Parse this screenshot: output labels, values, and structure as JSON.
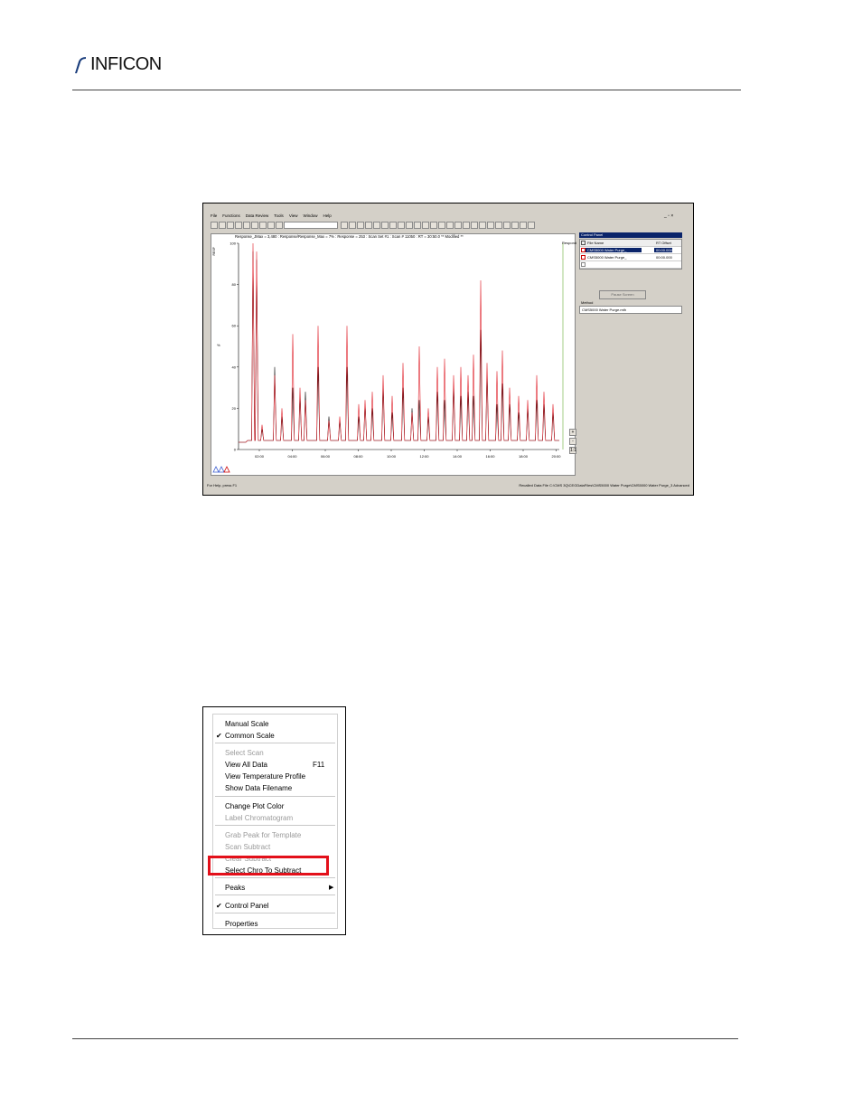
{
  "header": {
    "brand": "INFICON"
  },
  "screenshot1": {
    "menu": [
      "File",
      "Functions",
      "Data Review",
      "Tools",
      "View",
      "Window",
      "Help"
    ],
    "window_controls": "_ ▫ ×",
    "plot_header": "Response_JMax = 3,480 : Response/Response_Max = 7% : Response = 253 : Scan Set #1 : Scan # 11050 : RT = 30:50.0 ** Modified **",
    "respond_label": "Respond",
    "y_unit": "%",
    "y_ticks": [
      "100",
      "80",
      "60",
      "40",
      "20",
      "0"
    ],
    "x_ticks": [
      "02:00",
      "04:00",
      "06:00",
      "08:00",
      "10:00",
      "12:00",
      "14:00",
      "16:00",
      "18:00",
      "20:00"
    ],
    "y_axis_label": "RESP",
    "control_panel": {
      "title": "Control Panel",
      "col_file": "File Name",
      "col_rt": "RT Offset",
      "rows": [
        {
          "file": "CMS5000 Water Purge_",
          "rt": "00:00.000"
        },
        {
          "file": "CMS5000 Water Purge_",
          "rt": "00:00.000"
        }
      ],
      "pause_button": "Pause Screen",
      "method_label": "Method",
      "method_value": "CMS5000 Water Purge.mth"
    },
    "status_left": "For Help, press F1",
    "status_right": "Recalled Data File C:\\CMS 3Q\\CEGDataFiles\\CMS5000 Water Purge\\CMS5000 Water Purge_3 Advanced",
    "zoom_buttons": [
      "+",
      "-",
      "1:1"
    ]
  },
  "context_menu": {
    "items": [
      {
        "label": "Manual Scale",
        "disabled": false,
        "checked": false
      },
      {
        "label": "Common Scale",
        "disabled": false,
        "checked": true
      },
      {
        "label": "Select Scan",
        "disabled": true,
        "checked": false
      },
      {
        "label": "View All Data",
        "shortcut": "F11",
        "disabled": false,
        "checked": false
      },
      {
        "label": "View Temperature Profile",
        "disabled": false,
        "checked": false
      },
      {
        "label": "Show Data Filename",
        "disabled": false,
        "checked": false
      },
      {
        "label": "Change Plot Color",
        "disabled": false,
        "checked": false
      },
      {
        "label": "Label Chromatogram",
        "disabled": true,
        "checked": false
      },
      {
        "label": "Grab Peak for Template",
        "disabled": true,
        "checked": false
      },
      {
        "label": "Scan Subtract",
        "disabled": true,
        "checked": false
      },
      {
        "label": "Clear Subtract",
        "disabled": true,
        "checked": false
      },
      {
        "label": "Select Chro To Subtract",
        "disabled": false,
        "checked": false
      },
      {
        "label": "Peaks",
        "disabled": false,
        "checked": false,
        "submenu": true
      },
      {
        "label": "Control Panel",
        "disabled": false,
        "checked": true
      },
      {
        "label": "Properties",
        "disabled": false,
        "checked": false
      }
    ],
    "check_glyph": "✔",
    "arrow_glyph": "▶"
  },
  "colors": {
    "highlight": "#e3101a",
    "trace_red": "#e0202a",
    "trace_black": "#111111"
  }
}
